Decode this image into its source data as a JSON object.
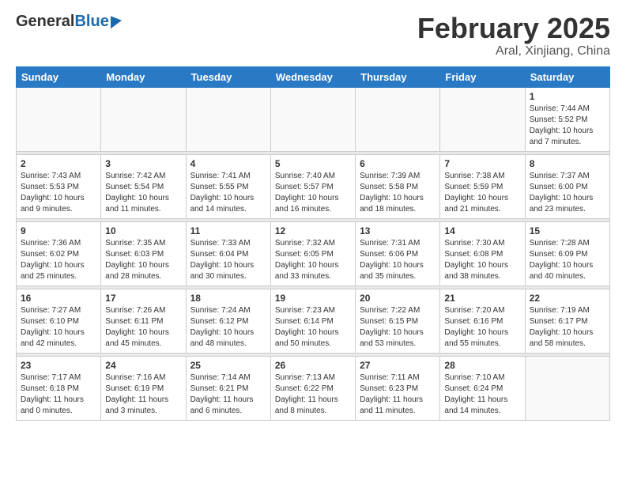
{
  "header": {
    "logo_general": "General",
    "logo_blue": "Blue",
    "month_title": "February 2025",
    "location": "Aral, Xinjiang, China"
  },
  "weekdays": [
    "Sunday",
    "Monday",
    "Tuesday",
    "Wednesday",
    "Thursday",
    "Friday",
    "Saturday"
  ],
  "weeks": [
    [
      {
        "day": "",
        "info": ""
      },
      {
        "day": "",
        "info": ""
      },
      {
        "day": "",
        "info": ""
      },
      {
        "day": "",
        "info": ""
      },
      {
        "day": "",
        "info": ""
      },
      {
        "day": "",
        "info": ""
      },
      {
        "day": "1",
        "info": "Sunrise: 7:44 AM\nSunset: 5:52 PM\nDaylight: 10 hours and 7 minutes."
      }
    ],
    [
      {
        "day": "2",
        "info": "Sunrise: 7:43 AM\nSunset: 5:53 PM\nDaylight: 10 hours and 9 minutes."
      },
      {
        "day": "3",
        "info": "Sunrise: 7:42 AM\nSunset: 5:54 PM\nDaylight: 10 hours and 11 minutes."
      },
      {
        "day": "4",
        "info": "Sunrise: 7:41 AM\nSunset: 5:55 PM\nDaylight: 10 hours and 14 minutes."
      },
      {
        "day": "5",
        "info": "Sunrise: 7:40 AM\nSunset: 5:57 PM\nDaylight: 10 hours and 16 minutes."
      },
      {
        "day": "6",
        "info": "Sunrise: 7:39 AM\nSunset: 5:58 PM\nDaylight: 10 hours and 18 minutes."
      },
      {
        "day": "7",
        "info": "Sunrise: 7:38 AM\nSunset: 5:59 PM\nDaylight: 10 hours and 21 minutes."
      },
      {
        "day": "8",
        "info": "Sunrise: 7:37 AM\nSunset: 6:00 PM\nDaylight: 10 hours and 23 minutes."
      }
    ],
    [
      {
        "day": "9",
        "info": "Sunrise: 7:36 AM\nSunset: 6:02 PM\nDaylight: 10 hours and 25 minutes."
      },
      {
        "day": "10",
        "info": "Sunrise: 7:35 AM\nSunset: 6:03 PM\nDaylight: 10 hours and 28 minutes."
      },
      {
        "day": "11",
        "info": "Sunrise: 7:33 AM\nSunset: 6:04 PM\nDaylight: 10 hours and 30 minutes."
      },
      {
        "day": "12",
        "info": "Sunrise: 7:32 AM\nSunset: 6:05 PM\nDaylight: 10 hours and 33 minutes."
      },
      {
        "day": "13",
        "info": "Sunrise: 7:31 AM\nSunset: 6:06 PM\nDaylight: 10 hours and 35 minutes."
      },
      {
        "day": "14",
        "info": "Sunrise: 7:30 AM\nSunset: 6:08 PM\nDaylight: 10 hours and 38 minutes."
      },
      {
        "day": "15",
        "info": "Sunrise: 7:28 AM\nSunset: 6:09 PM\nDaylight: 10 hours and 40 minutes."
      }
    ],
    [
      {
        "day": "16",
        "info": "Sunrise: 7:27 AM\nSunset: 6:10 PM\nDaylight: 10 hours and 42 minutes."
      },
      {
        "day": "17",
        "info": "Sunrise: 7:26 AM\nSunset: 6:11 PM\nDaylight: 10 hours and 45 minutes."
      },
      {
        "day": "18",
        "info": "Sunrise: 7:24 AM\nSunset: 6:12 PM\nDaylight: 10 hours and 48 minutes."
      },
      {
        "day": "19",
        "info": "Sunrise: 7:23 AM\nSunset: 6:14 PM\nDaylight: 10 hours and 50 minutes."
      },
      {
        "day": "20",
        "info": "Sunrise: 7:22 AM\nSunset: 6:15 PM\nDaylight: 10 hours and 53 minutes."
      },
      {
        "day": "21",
        "info": "Sunrise: 7:20 AM\nSunset: 6:16 PM\nDaylight: 10 hours and 55 minutes."
      },
      {
        "day": "22",
        "info": "Sunrise: 7:19 AM\nSunset: 6:17 PM\nDaylight: 10 hours and 58 minutes."
      }
    ],
    [
      {
        "day": "23",
        "info": "Sunrise: 7:17 AM\nSunset: 6:18 PM\nDaylight: 11 hours and 0 minutes."
      },
      {
        "day": "24",
        "info": "Sunrise: 7:16 AM\nSunset: 6:19 PM\nDaylight: 11 hours and 3 minutes."
      },
      {
        "day": "25",
        "info": "Sunrise: 7:14 AM\nSunset: 6:21 PM\nDaylight: 11 hours and 6 minutes."
      },
      {
        "day": "26",
        "info": "Sunrise: 7:13 AM\nSunset: 6:22 PM\nDaylight: 11 hours and 8 minutes."
      },
      {
        "day": "27",
        "info": "Sunrise: 7:11 AM\nSunset: 6:23 PM\nDaylight: 11 hours and 11 minutes."
      },
      {
        "day": "28",
        "info": "Sunrise: 7:10 AM\nSunset: 6:24 PM\nDaylight: 11 hours and 14 minutes."
      },
      {
        "day": "",
        "info": ""
      }
    ]
  ]
}
